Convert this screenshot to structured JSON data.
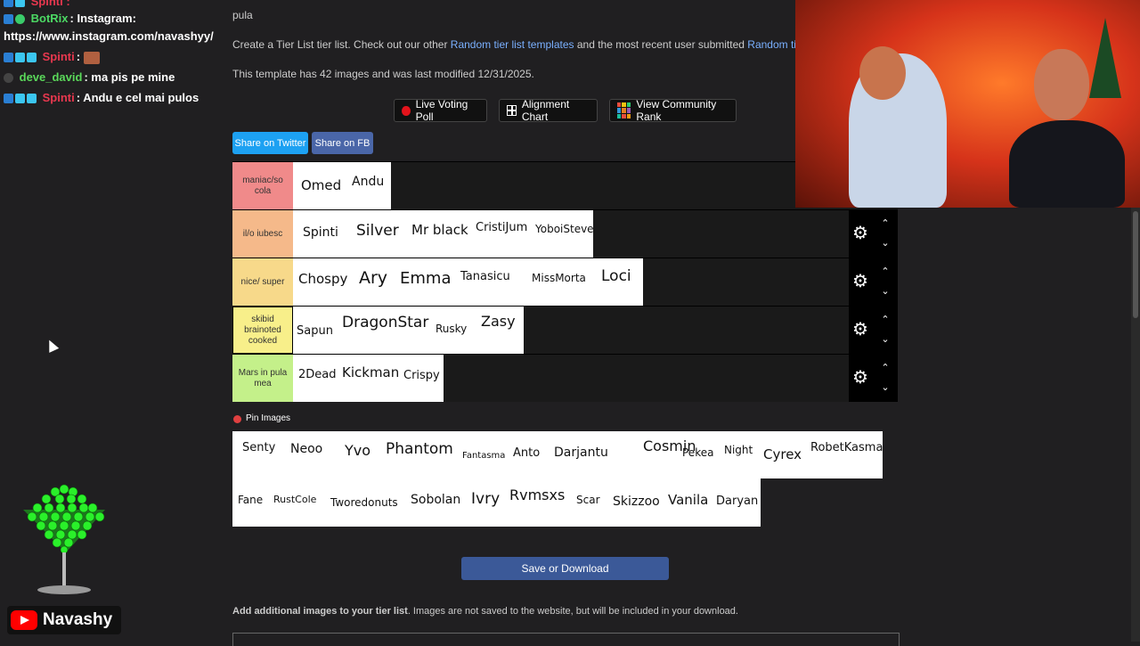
{
  "chat": {
    "lines": [
      {
        "name": "BotRix",
        "name_color": "#4cd964",
        "message": ": Instagram:"
      },
      {
        "message": "https://www.instagram.com/navashyy/"
      },
      {
        "name": "Spinti",
        "name_color": "#e8384f",
        "message": ":"
      },
      {
        "name": "deve_david",
        "name_color": "#5ad85a",
        "message": ": ma pis pe mine"
      },
      {
        "name": "Spinti",
        "name_color": "#e8384f",
        "message": ": Andu e cel mai pulos"
      }
    ]
  },
  "streamer": {
    "name": "Navashy"
  },
  "page": {
    "top_text": "pula",
    "intro_prefix": "Create a Tier List tier list. Check out our other ",
    "intro_link1": "Random tier list templates",
    "intro_mid": " and the most recent user submitted ",
    "intro_link2": "Random tier lists",
    "template_info": "This template has 42 images and was last modified 12/31/2025.",
    "buttons": {
      "live_voting": "Live Voting Poll",
      "alignment": "Alignment Chart",
      "community": "View Community Rank"
    },
    "share_twitter": "Share on Twitter",
    "share_fb": "Share on FB",
    "pin_images": "Pin Images",
    "save_download": "Save or Download",
    "add_images_bold": "Add additional images to your tier list",
    "add_images_rest": ". Images are not saved to the website, but will be included in your download."
  },
  "tiers": [
    {
      "label": "maniac/so cola",
      "color": "#f08a8a",
      "items": [
        "Omed",
        "Andu"
      ]
    },
    {
      "label": "il/o iubesc",
      "color": "#f5b98a",
      "items": [
        "Spinti",
        "Silver",
        "Mr black",
        "CristiJum",
        "YoboiSteve"
      ]
    },
    {
      "label": "nice/ super",
      "color": "#f7d98a",
      "items": [
        "Chospy",
        "Ary",
        "Emma",
        "Tanasicu",
        "MissMorta",
        "Loci"
      ]
    },
    {
      "label": "skibid brainoted cooked",
      "color": "#f8ef8a",
      "items": [
        "Sapun",
        "DragonStar",
        "Rusky",
        "Zasy"
      ]
    },
    {
      "label": "Mars in pula mea",
      "color": "#c4f08a",
      "items": [
        "2Dead",
        "Kickman",
        "Crispy"
      ]
    }
  ],
  "pool_row1": [
    "Senty",
    "Neoo",
    "Yvo",
    "Phantom",
    "Fantasma",
    "Anto",
    "Darjantu",
    "Cosmin",
    "Pekea",
    "Night",
    "Cyrex",
    "RobetKasma"
  ],
  "pool_row2": [
    "Fane",
    "RustCole",
    "Tworedonuts",
    "Sobolan",
    "Ivry",
    "Rvmsxs",
    "Scar",
    "Skizzoo",
    "Vanila",
    "Daryan"
  ]
}
